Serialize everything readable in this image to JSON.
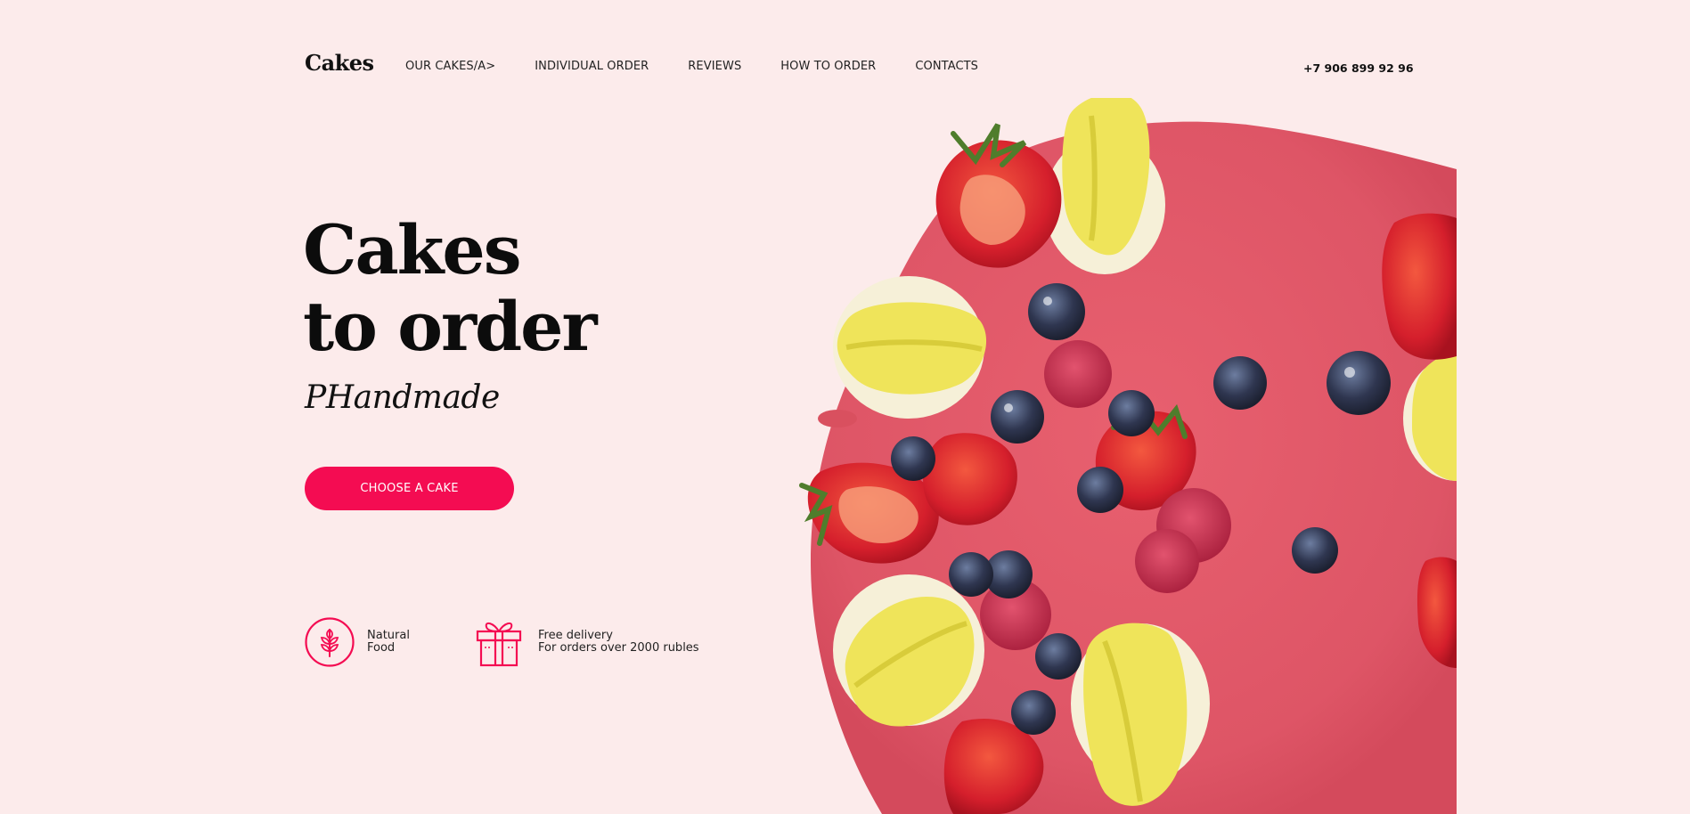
{
  "header": {
    "logo": "Cakes",
    "nav": [
      "OUR CAKES/A>",
      "INDIVIDUAL ORDER",
      "REVIEWS",
      "HOW TO ORDER",
      "CONTACTS"
    ],
    "phone": "+7 906 899 92 96"
  },
  "hero": {
    "title_line1": "Cakes",
    "title_line2": "to order",
    "subtitle": "PHandmade",
    "cta_label": "CHOOSE A CAKE",
    "image_icon": "cake-photo"
  },
  "features": [
    {
      "icon": "wheat-icon",
      "line1": "Natural",
      "line2": "Food"
    },
    {
      "icon": "gift-icon",
      "line1": "Free delivery",
      "line2": "For orders over 2000 rubles"
    }
  ],
  "colors": {
    "background": "#fcebeb",
    "accent": "#f40c52",
    "text": "#111111",
    "glaze": "#e35c6a"
  }
}
